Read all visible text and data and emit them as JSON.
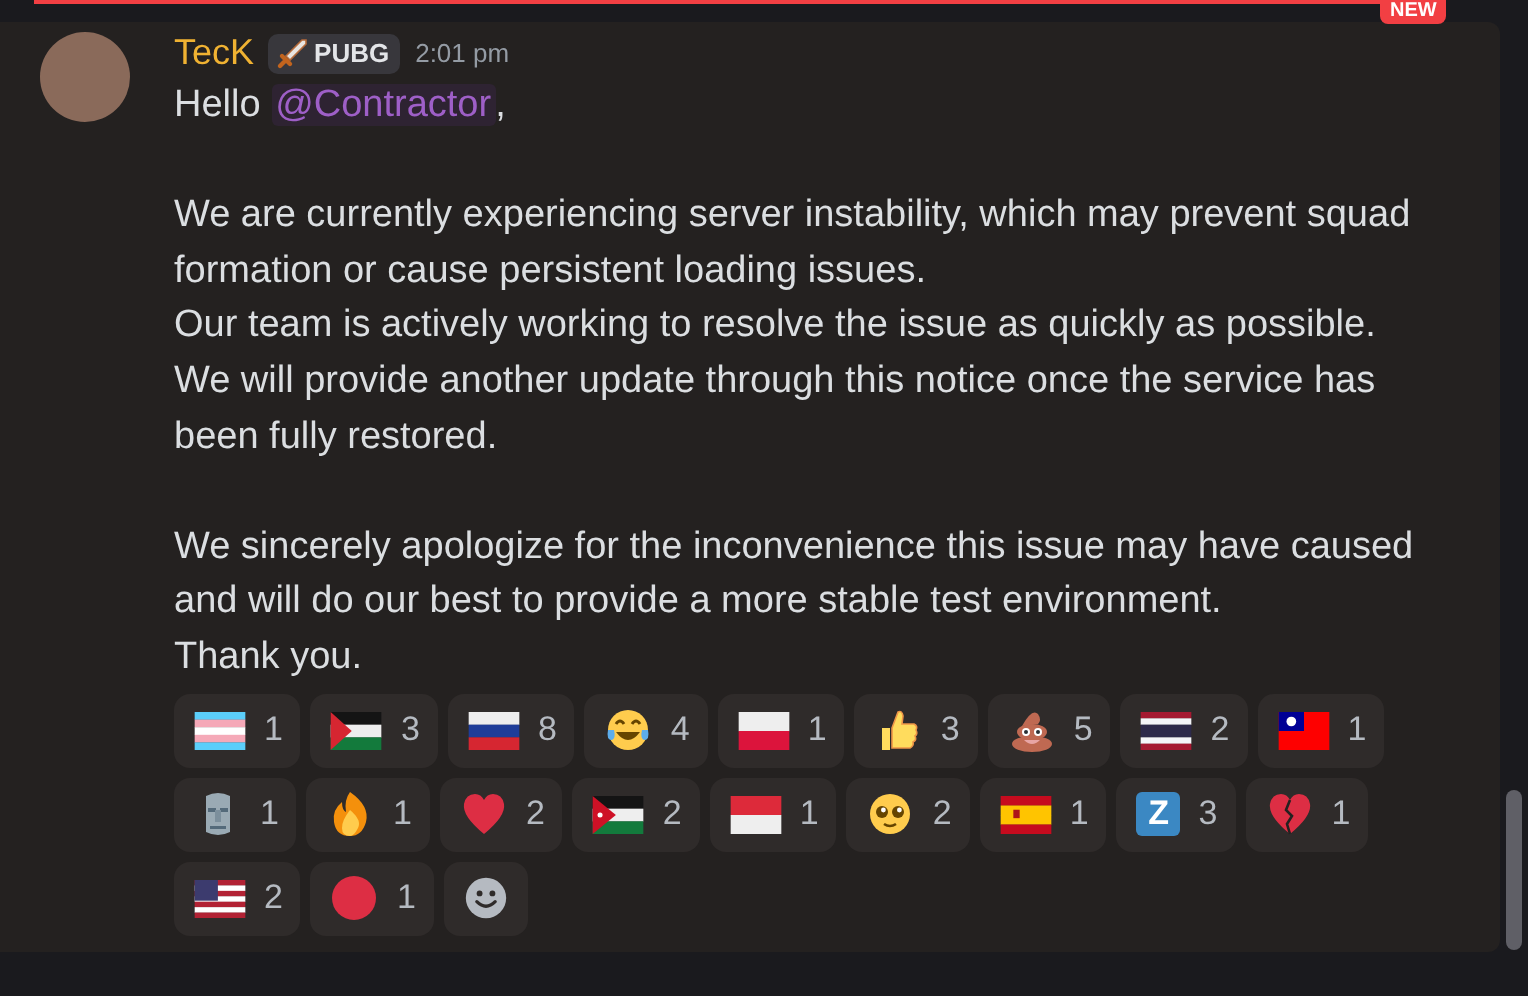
{
  "new_divider": {
    "badge": "NEW"
  },
  "message": {
    "author": "TecK",
    "tag": "PUBG",
    "time": "2:01 pm",
    "greeting": {
      "before": "Hello ",
      "mention": "@Contractor",
      "after": ","
    },
    "paragraphs": [
      "We are currently experiencing server instability, which may prevent squad formation or cause persistent loading issues.\nOur team is actively working to resolve the issue as quickly as possible.\nWe will provide another update through this notice once the service has been fully restored.",
      "We sincerely apologize for the inconvenience this issue may have caused and will do our best to provide a more stable test environment.\nThank you."
    ],
    "reactions": [
      {
        "kind": "trans-flag",
        "count": "1"
      },
      {
        "kind": "palestine-flag",
        "count": "3"
      },
      {
        "kind": "russia-flag",
        "count": "8"
      },
      {
        "kind": "laughing",
        "count": "4"
      },
      {
        "kind": "poland-flag",
        "count": "1"
      },
      {
        "kind": "thumbs-up",
        "count": "3"
      },
      {
        "kind": "poop",
        "count": "5"
      },
      {
        "kind": "thailand-flag",
        "count": "2"
      },
      {
        "kind": "taiwan-flag",
        "count": "1"
      },
      {
        "kind": "moai",
        "count": "1"
      },
      {
        "kind": "fire",
        "count": "1"
      },
      {
        "kind": "heart",
        "count": "2"
      },
      {
        "kind": "jordan-flag",
        "count": "2"
      },
      {
        "kind": "indonesia-flag",
        "count": "1"
      },
      {
        "kind": "pleading",
        "count": "2"
      },
      {
        "kind": "spain-flag",
        "count": "1"
      },
      {
        "kind": "letter",
        "glyph": "Z",
        "count": "3"
      },
      {
        "kind": "broken-heart",
        "count": "1"
      },
      {
        "kind": "us-flag",
        "count": "2"
      },
      {
        "kind": "red-circle",
        "count": "1"
      }
    ]
  }
}
